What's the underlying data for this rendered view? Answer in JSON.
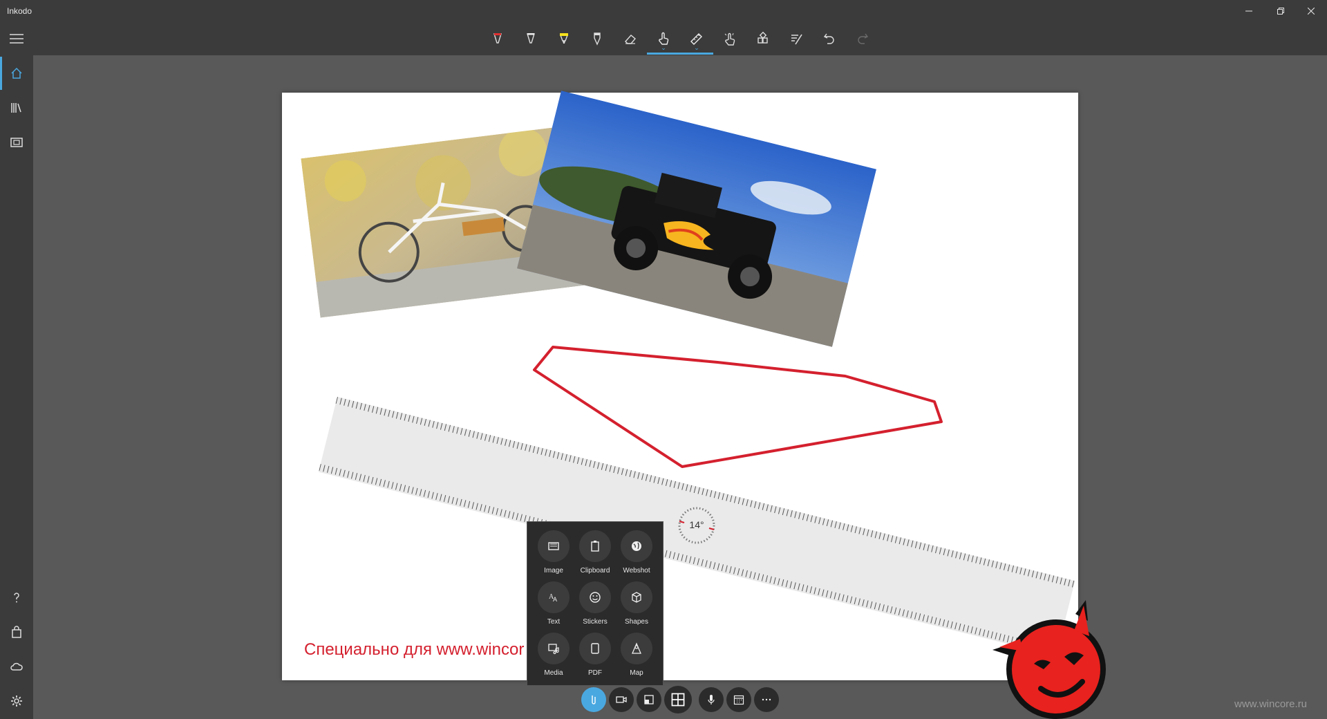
{
  "app": {
    "title": "Inkodo",
    "window_controls": [
      "minimize",
      "restore",
      "close"
    ]
  },
  "toolbar": {
    "tools": [
      {
        "icon": "red-pen-icon",
        "active": false
      },
      {
        "icon": "pencil-icon",
        "active": false
      },
      {
        "icon": "highlighter-icon",
        "active": false
      },
      {
        "icon": "fountain-pen-icon",
        "active": false
      },
      {
        "icon": "eraser-icon",
        "active": false
      },
      {
        "icon": "touch-hand-icon",
        "active": true
      },
      {
        "icon": "ruler-icon",
        "active": true
      },
      {
        "icon": "touch-select-icon",
        "active": false
      },
      {
        "icon": "add-object-icon",
        "active": false
      },
      {
        "icon": "ink-to-text-icon",
        "active": false
      },
      {
        "icon": "undo-icon",
        "active": false
      },
      {
        "icon": "redo-icon",
        "active": false,
        "disabled": true
      }
    ],
    "accent_color": "#4aa8e0"
  },
  "sidebar": {
    "top_items": [
      {
        "icon": "home-icon",
        "active": true
      },
      {
        "icon": "library-icon",
        "active": false
      },
      {
        "icon": "slideshow-icon",
        "active": false
      }
    ],
    "bottom_items": [
      {
        "icon": "help-icon"
      },
      {
        "icon": "store-bag-icon"
      },
      {
        "icon": "cloud-icon"
      },
      {
        "icon": "settings-icon"
      }
    ]
  },
  "canvas": {
    "ruler_angle_label": "14°",
    "watermark_text": "Специально для www.wincor",
    "ink_color": "#d4202e"
  },
  "insert_menu": {
    "items": [
      {
        "label": "Image",
        "icon": "image-icon"
      },
      {
        "label": "Clipboard",
        "icon": "clipboard-icon"
      },
      {
        "label": "Webshot",
        "icon": "globe-icon"
      },
      {
        "label": "Text",
        "icon": "text-icon"
      },
      {
        "label": "Stickers",
        "icon": "smiley-icon"
      },
      {
        "label": "Shapes",
        "icon": "cube-icon"
      },
      {
        "label": "Media",
        "icon": "media-icon"
      },
      {
        "label": "PDF",
        "icon": "pdf-icon"
      },
      {
        "label": "Map",
        "icon": "map-icon"
      }
    ]
  },
  "bottom_bar": {
    "buttons": [
      {
        "icon": "attach-icon",
        "active": true
      },
      {
        "icon": "video-camera-icon"
      },
      {
        "icon": "layout-icon"
      },
      {
        "icon": "grid-icon"
      },
      {
        "icon": "microphone-icon"
      },
      {
        "icon": "calendar-icon"
      },
      {
        "icon": "more-icon"
      }
    ]
  },
  "site_watermark": "www.wincore.ru"
}
